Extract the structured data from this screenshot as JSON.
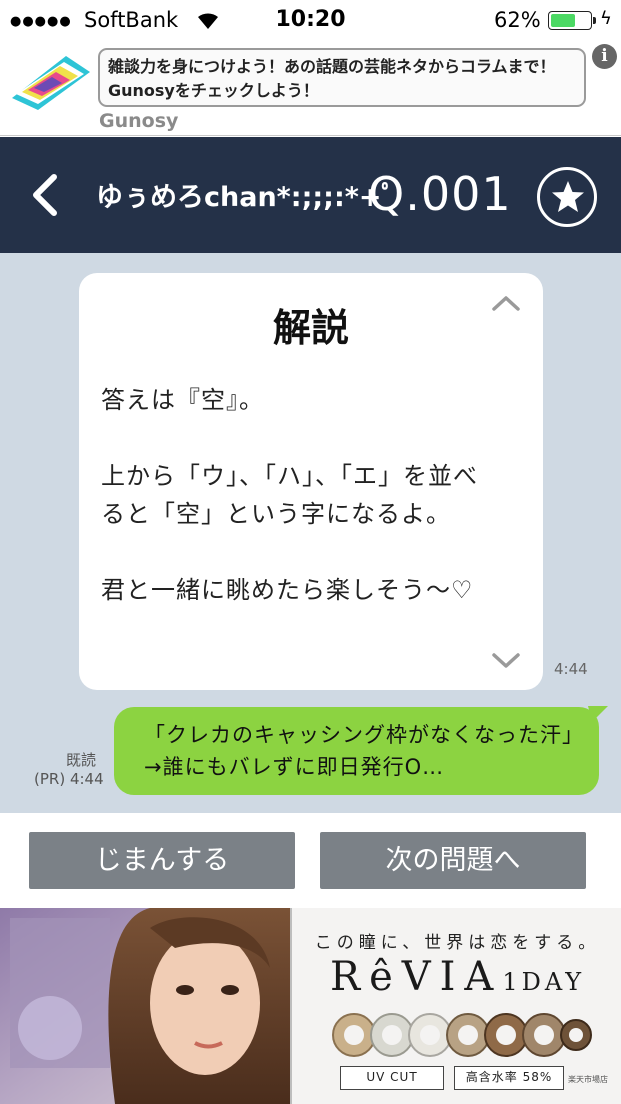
{
  "status_bar": {
    "dots": "●●●●●",
    "carrier": "SoftBank",
    "time": "10:20",
    "battery_percent": "62%",
    "battery_level": 0.62,
    "charging_icon": "bolt-icon"
  },
  "top_ad": {
    "text": "雑談力を身につけよう！あの話題の芸能ネタからコラムまで！Gunosyをチェックしよう！",
    "source": "Gunosy",
    "info_icon": "i"
  },
  "nav": {
    "title": "ゆぅめろchan*:;;;:*+ﾟ",
    "question_number": "Q.001"
  },
  "explanation_card": {
    "title": "解説",
    "paragraphs": [
      "答えは『空』。",
      "上から「ウ」、「ハ」、「エ」を並べると「空」という字になるよ。",
      "君と一緒に眺めたら楽しそう〜♡"
    ],
    "timestamp": "4:44"
  },
  "pr_message": {
    "text": "「クレカのキャッシング枠がなくなった汗」→誰にもバレずに即日発行O…",
    "read_label": "既読",
    "time_label": "(PR) 4:44"
  },
  "buttons": {
    "boast": "じまんする",
    "next": "次の問題へ"
  },
  "bottom_ad": {
    "tagline": "この瞳に、世界は恋をする。",
    "brand": "RêVIA",
    "brand_suffix": "1DAY",
    "tag_uv": "UV CUT",
    "tag_water": "高含水率 58%",
    "small_text": "楽天市場店"
  }
}
